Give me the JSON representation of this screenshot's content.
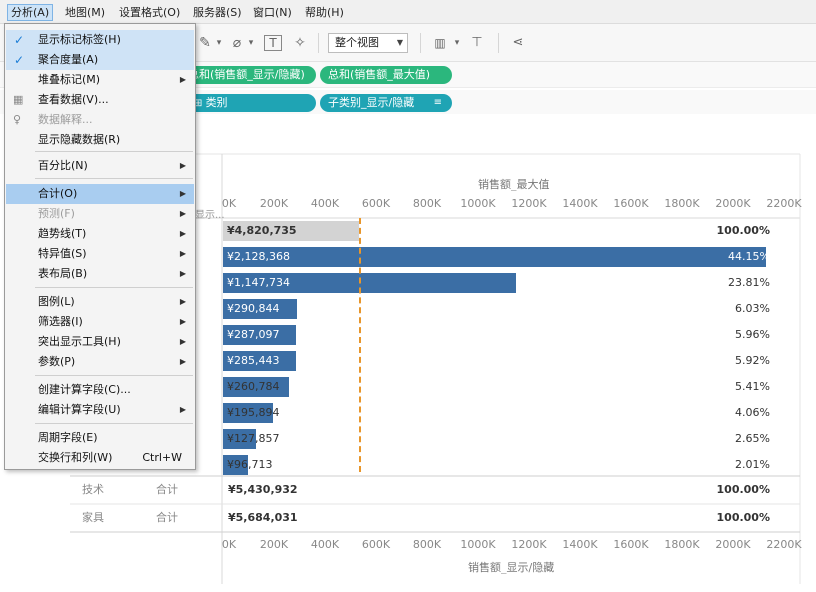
{
  "menubar": {
    "items": [
      "分析(A)",
      "地图(M)",
      "设置格式(O)",
      "服务器(S)",
      "窗口(N)",
      "帮助(H)"
    ]
  },
  "toolbar": {
    "fit_select": "整个视图"
  },
  "shelves": {
    "columns_pills": [
      "总和(销售额_显示/隐藏)",
      "总和(销售额_最大值)"
    ],
    "rows_pills": [
      "类别",
      "子类别_显示/隐藏"
    ]
  },
  "menu": {
    "items": [
      {
        "label": "显示标记标签(H)",
        "checked": true
      },
      {
        "label": "聚合度量(A)",
        "checked": true
      },
      {
        "label": "堆叠标记(M)",
        "submenu": true
      },
      {
        "label": "查看数据(V)...",
        "icon": "table-icon"
      },
      {
        "label": "数据解释...",
        "disabled": true,
        "icon": "lightbulb-icon"
      },
      {
        "label": "显示隐藏数据(R)"
      },
      {
        "label": "百分比(N)",
        "submenu": true
      },
      {
        "label": "合计(O)",
        "submenu": true,
        "highlighted": true
      },
      {
        "label": "预测(F)",
        "submenu": true,
        "disabled": true
      },
      {
        "label": "趋势线(T)",
        "submenu": true
      },
      {
        "label": "特异值(S)",
        "submenu": true
      },
      {
        "label": "表布局(B)",
        "submenu": true
      },
      {
        "label": "图例(L)",
        "submenu": true
      },
      {
        "label": "筛选器(I)",
        "submenu": true
      },
      {
        "label": "突出显示工具(H)",
        "submenu": true
      },
      {
        "label": "参数(P)",
        "submenu": true
      },
      {
        "label": "创建计算字段(C)..."
      },
      {
        "label": "编辑计算字段(U)",
        "submenu": true
      },
      {
        "label": "周期字段(E)"
      },
      {
        "label": "交换行和列(W)",
        "shortcut": "Ctrl+W"
      }
    ]
  },
  "view": {
    "top_axis_title": "销售额_最大值",
    "bottom_axis_title": "销售额_显示/隐藏",
    "clipped_header": "显示...",
    "ticks": [
      "0K",
      "200K",
      "400K",
      "600K",
      "800K",
      "1000K",
      "1200K",
      "1400K",
      "1600K",
      "1800K",
      "2000K",
      "2200K"
    ]
  },
  "chart_data": {
    "type": "bar",
    "orientation": "horizontal",
    "xlabel": "销售额_显示/隐藏",
    "x_range": [
      0,
      2200000
    ],
    "x_unit": "K",
    "reference_line_x": 530000,
    "rows": [
      {
        "value_label": "¥4,820,735",
        "value": 4820735,
        "pct": "100.00%",
        "total": true
      },
      {
        "value_label": "¥2,128,368",
        "value": 2128368,
        "pct": "44.15%"
      },
      {
        "value_label": "¥1,147,734",
        "value": 1147734,
        "pct": "23.81%"
      },
      {
        "value_label": "¥290,844",
        "value": 290844,
        "pct": "6.03%"
      },
      {
        "value_label": "¥287,097",
        "value": 287097,
        "pct": "5.96%"
      },
      {
        "value_label": "¥285,443",
        "value": 285443,
        "pct": "5.92%"
      },
      {
        "value_label": "¥260,784",
        "value": 260784,
        "pct": "5.41%"
      },
      {
        "value_label": "¥195,894",
        "value": 195894,
        "pct": "4.06%"
      },
      {
        "value_label": "¥127,857",
        "value": 127857,
        "pct": "2.65%"
      },
      {
        "value_label": "¥96,713",
        "value": 96713,
        "pct": "2.01%"
      }
    ],
    "category_totals": [
      {
        "category": "技术",
        "subtotal_label": "合计",
        "value_label": "¥5,430,932",
        "pct": "100.00%"
      },
      {
        "category": "家具",
        "subtotal_label": "合计",
        "value_label": "¥5,684,031",
        "pct": "100.00%"
      }
    ]
  }
}
